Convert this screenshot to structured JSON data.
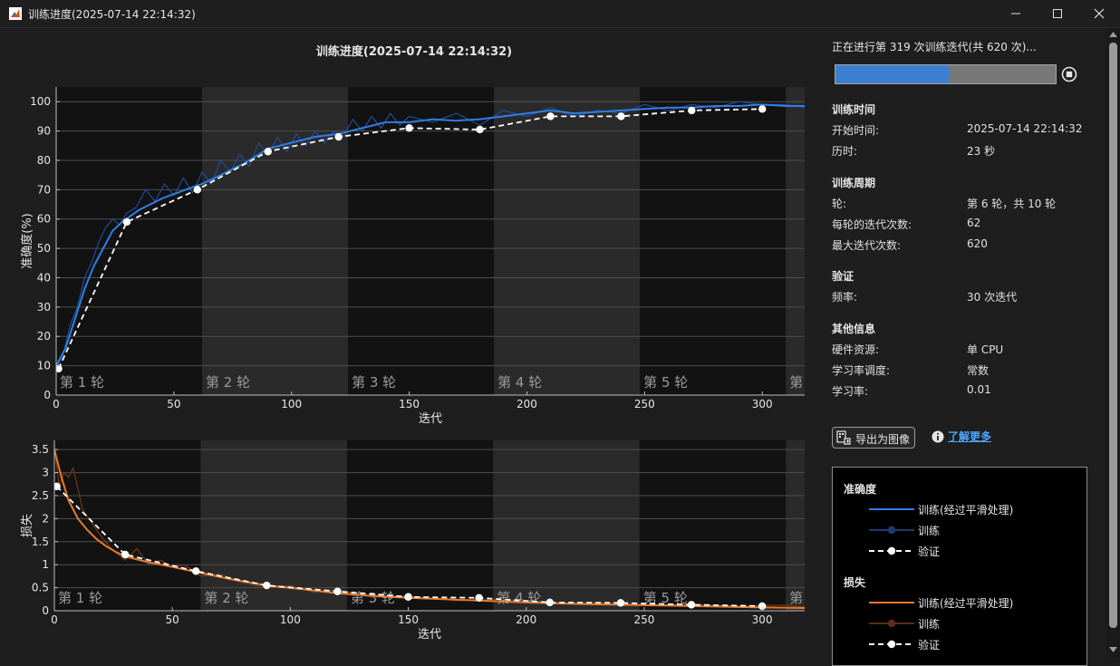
{
  "window": {
    "title": "训练进度(2025-07-14 22:14:32)"
  },
  "chart_data": [
    {
      "type": "line",
      "title": "训练进度(2025-07-14 22:14:32)",
      "xlabel": "迭代",
      "ylabel": "准确度(%)",
      "xlim": [
        0,
        318
      ],
      "ylim": [
        0,
        105
      ],
      "xticks": [
        0,
        50,
        100,
        150,
        200,
        250,
        300
      ],
      "yticks": [
        0,
        10,
        20,
        30,
        40,
        50,
        60,
        70,
        80,
        90,
        100
      ],
      "epochs": [
        {
          "label": "第 1 轮",
          "start": 0,
          "end": 62
        },
        {
          "label": "第 2 轮",
          "start": 62,
          "end": 124
        },
        {
          "label": "第 3 轮",
          "start": 124,
          "end": 186
        },
        {
          "label": "第 4 轮",
          "start": 186,
          "end": 248
        },
        {
          "label": "第 5 轮",
          "start": 248,
          "end": 310
        },
        {
          "label": "第",
          "start": 310,
          "end": 372
        }
      ],
      "series": [
        {
          "name": "训练(经过平滑处理)",
          "color": "#2f7ee6",
          "x": [
            0,
            4,
            8,
            12,
            16,
            20,
            24,
            28,
            35,
            45,
            55,
            62,
            70,
            80,
            90,
            100,
            110,
            120,
            130,
            140,
            150,
            160,
            170,
            180,
            190,
            200,
            210,
            220,
            230,
            240,
            250,
            260,
            270,
            280,
            290,
            300,
            310,
            318
          ],
          "y": [
            10,
            16,
            26,
            36,
            44,
            50,
            56,
            59,
            63,
            67,
            70,
            72,
            75,
            79,
            84,
            86,
            88,
            89,
            91,
            93,
            93,
            94,
            93.5,
            94,
            95,
            96,
            97,
            96,
            96.5,
            97,
            97.5,
            98,
            98,
            98.5,
            98.5,
            99,
            98.5,
            98.5
          ]
        },
        {
          "name": "训练",
          "color": "#1f4c9a",
          "x": [
            0,
            3,
            6,
            9,
            12,
            15,
            18,
            21,
            24,
            27,
            30,
            34,
            38,
            42,
            46,
            50,
            54,
            58,
            62,
            66,
            70,
            74,
            78,
            82,
            86,
            90,
            94,
            98,
            102,
            106,
            110,
            114,
            118,
            122,
            126,
            130,
            134,
            138,
            142,
            146,
            150,
            160,
            170,
            180,
            190,
            200,
            210,
            220,
            230,
            240,
            250,
            260,
            270,
            280,
            290,
            300,
            310,
            318
          ],
          "y": [
            9,
            14,
            24,
            30,
            40,
            45,
            52,
            57,
            60,
            58,
            62,
            64,
            70,
            66,
            72,
            68,
            74,
            69,
            76,
            72,
            80,
            76,
            82,
            78,
            86,
            82,
            88,
            83,
            89,
            85,
            90,
            86,
            90,
            88,
            94,
            90,
            95,
            91,
            96,
            92,
            95,
            93,
            96,
            92,
            97,
            95,
            98,
            95,
            97,
            96,
            99,
            97,
            99,
            98,
            100,
            99,
            99,
            98
          ]
        },
        {
          "name": "验证",
          "color": "#ffffff",
          "x": [
            1,
            30,
            60,
            90,
            120,
            150,
            180,
            210,
            240,
            270,
            300
          ],
          "y": [
            9,
            59,
            70,
            83,
            88,
            91,
            90.5,
            95,
            95,
            97,
            97.5
          ]
        }
      ]
    },
    {
      "type": "line",
      "xlabel": "迭代",
      "ylabel": "损失",
      "xlim": [
        0,
        318
      ],
      "ylim": [
        0,
        3.7
      ],
      "xticks": [
        0,
        50,
        100,
        150,
        200,
        250,
        300
      ],
      "yticks": [
        0,
        0.5,
        1,
        1.5,
        2,
        2.5,
        3,
        3.5
      ],
      "epochs": [
        {
          "label": "第 1 轮",
          "start": 0,
          "end": 62
        },
        {
          "label": "第 2 轮",
          "start": 62,
          "end": 124
        },
        {
          "label": "第 3 轮",
          "start": 124,
          "end": 186
        },
        {
          "label": "第 4 轮",
          "start": 186,
          "end": 248
        },
        {
          "label": "第 5 轮",
          "start": 248,
          "end": 310
        },
        {
          "label": "第",
          "start": 310,
          "end": 372
        }
      ],
      "series": [
        {
          "name": "训练(经过平滑处理)",
          "color": "#e87a2c",
          "x": [
            0,
            3,
            6,
            10,
            14,
            18,
            22,
            26,
            30,
            40,
            50,
            62,
            75,
            90,
            105,
            120,
            135,
            150,
            165,
            180,
            200,
            220,
            240,
            260,
            280,
            300,
            318
          ],
          "y": [
            3.5,
            2.9,
            2.4,
            2.0,
            1.75,
            1.55,
            1.4,
            1.28,
            1.18,
            1.05,
            0.95,
            0.82,
            0.68,
            0.55,
            0.47,
            0.38,
            0.32,
            0.28,
            0.25,
            0.22,
            0.18,
            0.15,
            0.13,
            0.11,
            0.09,
            0.07,
            0.06
          ]
        },
        {
          "name": "训练",
          "color": "#6e3a1a",
          "x": [
            0,
            2,
            4,
            6,
            8,
            12,
            16,
            20,
            25,
            30,
            35,
            40,
            45,
            50,
            55,
            62,
            70,
            80,
            90,
            100,
            110,
            120,
            135,
            150,
            170,
            190,
            210,
            230,
            250,
            270,
            290,
            310,
            318
          ],
          "y": [
            3.6,
            2.7,
            3.0,
            2.9,
            3.1,
            2.2,
            1.9,
            1.6,
            1.3,
            1.1,
            1.35,
            1.0,
            1.1,
            0.95,
            1.0,
            0.75,
            0.8,
            0.6,
            0.5,
            0.55,
            0.4,
            0.45,
            0.3,
            0.32,
            0.22,
            0.25,
            0.15,
            0.18,
            0.12,
            0.14,
            0.1,
            0.12,
            0.08
          ]
        },
        {
          "name": "验证",
          "color": "#ffffff",
          "x": [
            1,
            30,
            60,
            90,
            120,
            150,
            180,
            210,
            240,
            270,
            300
          ],
          "y": [
            2.7,
            1.22,
            0.86,
            0.55,
            0.42,
            0.3,
            0.28,
            0.18,
            0.17,
            0.13,
            0.1
          ]
        }
      ]
    }
  ],
  "panel": {
    "status": "正在进行第 319 次训练迭代(共 620 次)...",
    "progress": 0.514,
    "sections": [
      {
        "title": "训练时间",
        "rows": [
          {
            "label": "开始时间:",
            "value": "2025-07-14 22:14:32"
          },
          {
            "label": "历时:",
            "value": "23 秒"
          }
        ]
      },
      {
        "title": "训练周期",
        "rows": [
          {
            "label": "轮:",
            "value": "第 6 轮，共 10 轮"
          },
          {
            "label": "每轮的迭代次数:",
            "value": "62"
          },
          {
            "label": "最大迭代次数:",
            "value": "620"
          }
        ]
      },
      {
        "title": "验证",
        "rows": [
          {
            "label": "频率:",
            "value": "30 次迭代"
          }
        ]
      },
      {
        "title": "其他信息",
        "rows": [
          {
            "label": "硬件资源:",
            "value": "单 CPU"
          },
          {
            "label": "学习率调度:",
            "value": "常数"
          },
          {
            "label": "学习率:",
            "value": "0.01"
          }
        ]
      }
    ],
    "export_label": "导出为图像",
    "learn_more": "了解更多"
  },
  "legend": {
    "groups": [
      {
        "title": "准确度",
        "items": [
          {
            "label": "训练(经过平滑处理)",
            "style": "solid",
            "color": "#2f7ee6"
          },
          {
            "label": "训练",
            "style": "marker",
            "color": "#1f3a70"
          },
          {
            "label": "验证",
            "style": "dash",
            "color": "#ffffff"
          }
        ]
      },
      {
        "title": "损失",
        "items": [
          {
            "label": "训练(经过平滑处理)",
            "style": "solid",
            "color": "#e87a2c"
          },
          {
            "label": "训练",
            "style": "marker",
            "color": "#5a2e16"
          },
          {
            "label": "验证",
            "style": "dash",
            "color": "#ffffff"
          }
        ]
      }
    ]
  }
}
